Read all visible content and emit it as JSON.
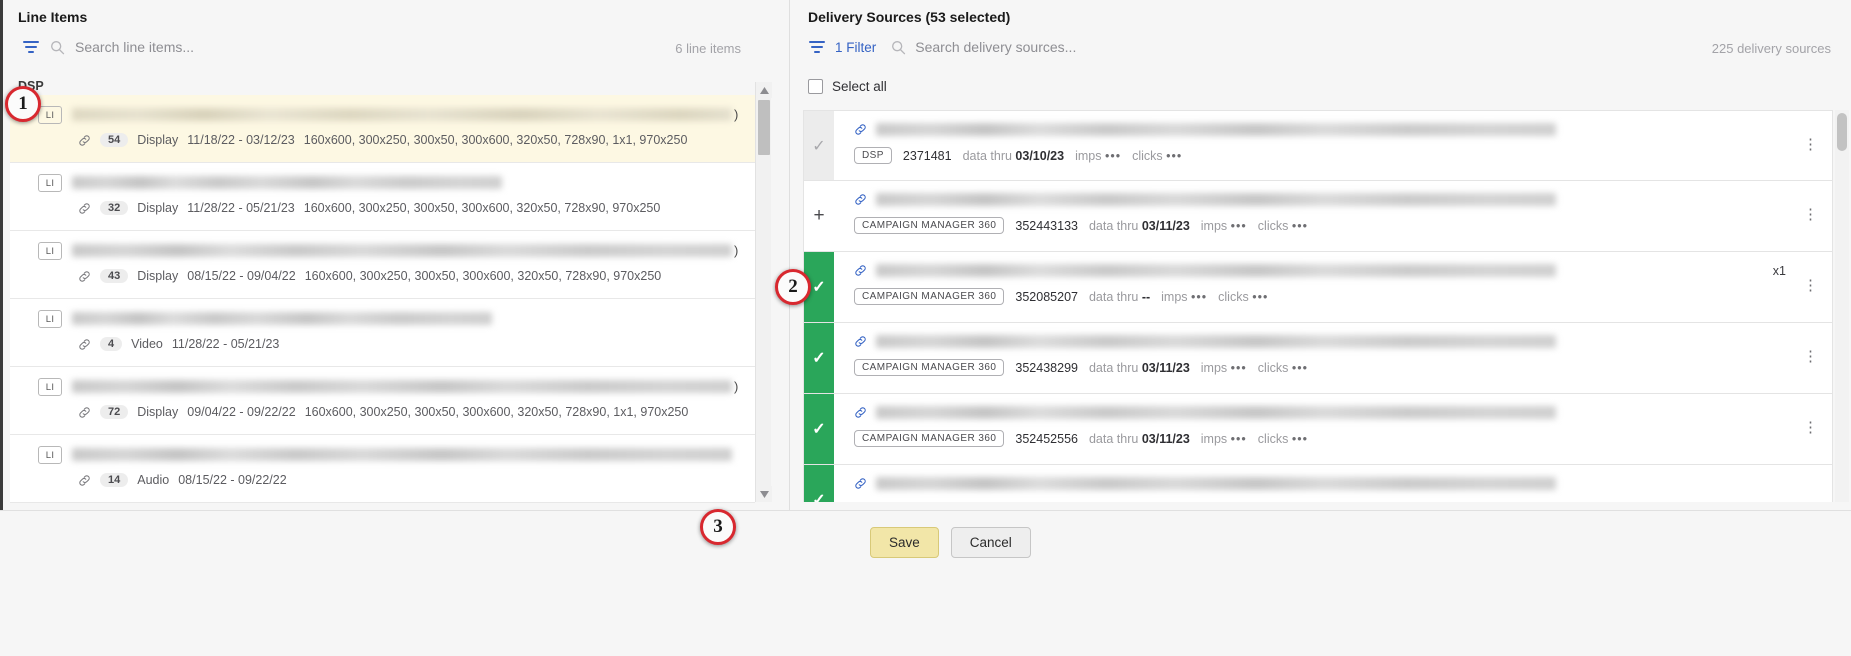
{
  "left": {
    "title": "Line Items",
    "search_placeholder": "Search line items...",
    "count_label": "6 line items",
    "section_label": "DSP",
    "filter_icon": "filter-icon",
    "search_icon": "search-icon",
    "badge_label": "LI",
    "rows": [
      {
        "badge": "LI",
        "links": "54",
        "type": "Display",
        "dates": "11/18/22 - 03/12/23",
        "sizes": "160x600, 300x250, 300x50, 300x600, 320x50, 728x90, 1x1, 970x250",
        "highlighted": true,
        "title_suffix": ")"
      },
      {
        "badge": "LI",
        "links": "32",
        "type": "Display",
        "dates": "11/28/22 - 05/21/23",
        "sizes": "160x600, 300x250, 300x50, 300x600, 320x50, 728x90, 970x250",
        "highlighted": false,
        "title_suffix": ""
      },
      {
        "badge": "LI",
        "links": "43",
        "type": "Display",
        "dates": "08/15/22 - 09/04/22",
        "sizes": "160x600, 300x250, 300x50, 300x600, 320x50, 728x90, 970x250",
        "highlighted": false,
        "title_suffix": ")"
      },
      {
        "badge": "LI",
        "links": "4",
        "type": "Video",
        "dates": "11/28/22 - 05/21/23",
        "sizes": "",
        "highlighted": false,
        "title_suffix": ""
      },
      {
        "badge": "LI",
        "links": "72",
        "type": "Display",
        "dates": "09/04/22 - 09/22/22",
        "sizes": "160x600, 300x250, 300x50, 300x600, 320x50, 728x90, 1x1, 970x250",
        "highlighted": false,
        "title_suffix": ")"
      },
      {
        "badge": "LI",
        "links": "14",
        "type": "Audio",
        "dates": "08/15/22 - 09/22/22",
        "sizes": "",
        "highlighted": false,
        "title_suffix": ""
      }
    ]
  },
  "right": {
    "title": "Delivery Sources (53 selected)",
    "filter_label": "1 Filter",
    "search_placeholder": "Search delivery sources...",
    "count_label": "225 delivery sources",
    "select_all_label": "Select all",
    "imps_label": "imps",
    "clicks_label": "clicks",
    "dots": "•••",
    "data_thru_label": "data thru",
    "kebab": "⋮",
    "rows": [
      {
        "state": "neutral",
        "state_glyph": "✓",
        "source": "DSP",
        "id": "2371481",
        "data_thru": "03/10/23",
        "x1": ""
      },
      {
        "state": "plus",
        "state_glyph": "+",
        "source": "CAMPAIGN MANAGER 360",
        "id": "352443133",
        "data_thru": "03/11/23",
        "x1": ""
      },
      {
        "state": "sel",
        "state_glyph": "✓",
        "source": "CAMPAIGN MANAGER 360",
        "id": "352085207",
        "data_thru": "--",
        "x1": "x1"
      },
      {
        "state": "sel",
        "state_glyph": "✓",
        "source": "CAMPAIGN MANAGER 360",
        "id": "352438299",
        "data_thru": "03/11/23",
        "x1": ""
      },
      {
        "state": "sel",
        "state_glyph": "✓",
        "source": "CAMPAIGN MANAGER 360",
        "id": "352452556",
        "data_thru": "03/11/23",
        "x1": ""
      },
      {
        "state": "sel",
        "state_glyph": "✓",
        "source": "",
        "id": "",
        "data_thru": "",
        "x1": ""
      }
    ]
  },
  "footer": {
    "save_label": "Save",
    "cancel_label": "Cancel"
  },
  "markers": {
    "m1": "1",
    "m2": "2",
    "m3": "3"
  }
}
